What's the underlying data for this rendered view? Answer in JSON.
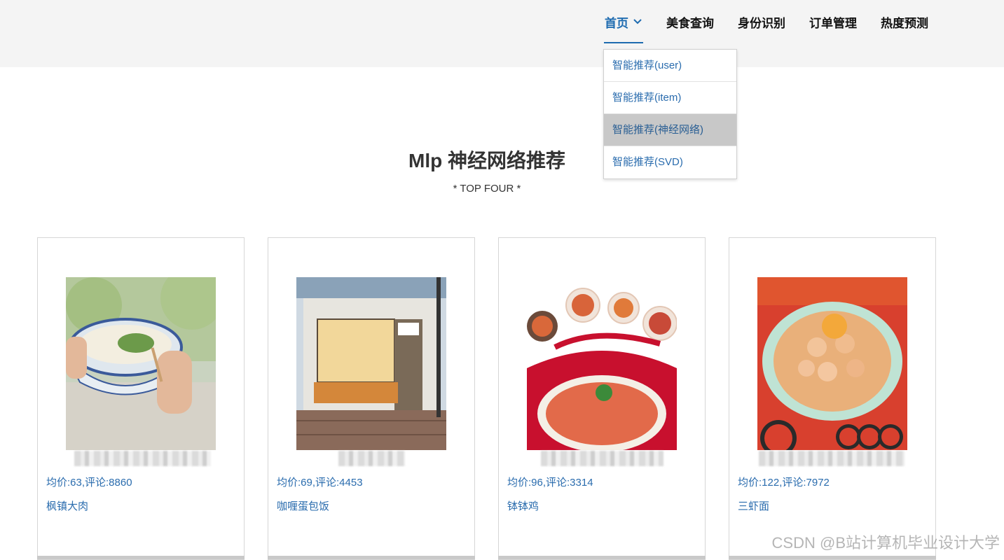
{
  "nav": {
    "items": [
      {
        "label": "首页"
      },
      {
        "label": "美食查询"
      },
      {
        "label": "身份识别"
      },
      {
        "label": "订单管理"
      },
      {
        "label": "热度预测"
      }
    ]
  },
  "dropdown": {
    "items": [
      {
        "label": "智能推荐(user)"
      },
      {
        "label": "智能推荐(item)"
      },
      {
        "label": "智能推荐(神经网络)"
      },
      {
        "label": "智能推荐(SVD)"
      }
    ]
  },
  "section": {
    "title": "Mlp 神经网络推荐",
    "subtitle": "* TOP FOUR *"
  },
  "cards": [
    {
      "price_text": "均价:63,评论:8860",
      "name": "枫镇大肉"
    },
    {
      "price_text": "均价:69,评论:4453",
      "name": "咖喱蛋包饭"
    },
    {
      "price_text": "均价:96,评论:3314",
      "name": "钵钵鸡"
    },
    {
      "price_text": "均价:122,评论:7972",
      "name": "三虾面"
    }
  ],
  "watermark": "CSDN @B站计算机毕业设计大学",
  "colors": {
    "accent": "#1e6bb0",
    "link": "#2a6cae",
    "header_bg": "#f4f4f4",
    "selected_bg": "#c8c8c8"
  }
}
